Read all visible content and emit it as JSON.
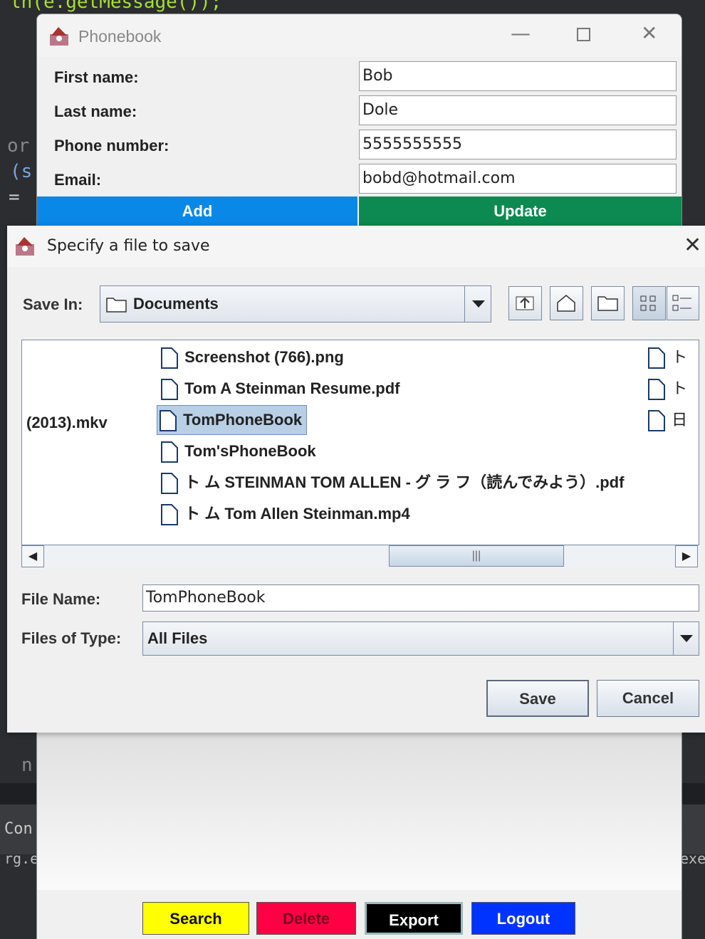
{
  "background_code": {
    "line1": "ln(e.getMessage());",
    "frag_or": "or",
    "frag_s": "(s",
    "frag_eq": "=",
    "frag_n": "n",
    "frag_con": "Con",
    "frag_rg": "rg.e",
    "frag_exe": "exe"
  },
  "phonebook": {
    "title": "Phonebook",
    "fields": [
      {
        "label": "First name:",
        "value": "Bob"
      },
      {
        "label": "Last name:",
        "value": "Dole"
      },
      {
        "label": "Phone number:",
        "value": "5555555555"
      },
      {
        "label": "Email:",
        "value": "bobd@hotmail.com"
      }
    ],
    "add_label": "Add",
    "update_label": "Update",
    "search_label": "Search",
    "delete_label": "Delete",
    "export_label": "Export",
    "logout_label": "Logout",
    "colors": {
      "add": "#0a88e8",
      "update": "#0d8a51",
      "search": "#ffff00",
      "delete": "#ff0044",
      "export": "#000000",
      "logout": "#0033ff"
    }
  },
  "dialog": {
    "title": "Specify a file to save",
    "save_in_label": "Save In:",
    "save_in_value": "Documents",
    "files": [
      {
        "name": "Screenshot (766).png",
        "selected": false
      },
      {
        "name": "Tom A Steinman Resume.pdf",
        "selected": false
      },
      {
        "name": "TomPhoneBook",
        "selected": true
      },
      {
        "name": "Tom'sPhoneBook",
        "selected": false
      },
      {
        "name": "ト ム STEINMAN TOM ALLEN - グ ラ フ（読んでみよう）.pdf",
        "selected": false
      },
      {
        "name": "ト ム Tom Allen Steinman.mp4",
        "selected": false
      }
    ],
    "left_column_partial": "(2013).mkv",
    "right_column_partial": [
      "ト",
      "ト",
      "日"
    ],
    "file_name_label": "File Name:",
    "file_name_value": "TomPhoneBook",
    "files_of_type_label": "Files of Type:",
    "files_of_type_value": "All Files",
    "save_label": "Save",
    "cancel_label": "Cancel"
  }
}
